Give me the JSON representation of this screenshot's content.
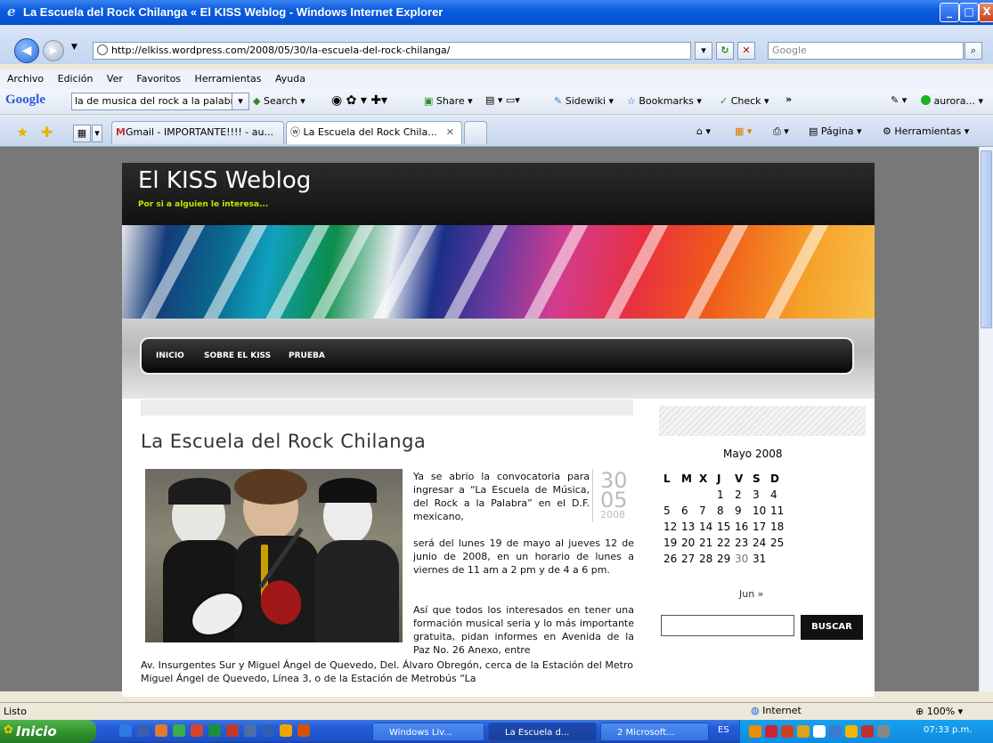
{
  "window": {
    "title": "La Escuela del Rock Chilanga « El KISS Weblog - Windows Internet Explorer",
    "controls": [
      "_",
      "□",
      "X"
    ]
  },
  "address": {
    "url": "http://elkiss.wordpress.com/2008/05/30/la-escuela-del-rock-chilanga/",
    "search_placeholder": "Google"
  },
  "menu": [
    "Archivo",
    "Edición",
    "Ver",
    "Favoritos",
    "Herramientas",
    "Ayuda"
  ],
  "googlebar": {
    "logo": "Google",
    "query": "la de musica del rock a la palabra",
    "search": "Search",
    "share": "Share",
    "sidewiki": "Sidewiki",
    "bookmarks": "Bookmarks",
    "check": "Check",
    "more": "»",
    "user": "aurora..."
  },
  "tabs": [
    {
      "label": "Gmail - IMPORTANTE!!!! - au..."
    },
    {
      "label": "La Escuela del Rock Chila..."
    }
  ],
  "commandbar": {
    "page": "Página",
    "tools": "Herramientas"
  },
  "site": {
    "title": "El KISS Weblog",
    "tagline": "Por si a alguien le interesa...",
    "nav": [
      "INICIO",
      "SOBRE EL KISS",
      "PRUEBA"
    ]
  },
  "post": {
    "title": "La Escuela del Rock Chilanga",
    "date": {
      "day": "30",
      "month": "05",
      "year": "2008"
    },
    "para1a": "Ya se abrio la convocatoria para ingresar a “La Escuela de Música, del Rock a la Palabra” en el D.F. mexicano,",
    "para1b": "será del lunes 19 de mayo al jueves 12 de junio de 2008, en un horario de lunes a viernes de 11 am a 2 pm y de 4 a 6 pm.",
    "para2": "Así que todos los interesados en tener una formación musical seria y lo más importante gratuita, pidan informes en Avenida de la Paz No. 26 Anexo, entre",
    "para3": "Av. Insurgentes Sur y Miguel Ángel de Quevedo, Del. Álvaro Obregón, cerca de la Estación del Metro Miguel Ángel de Quevedo, Línea 3, o de la Estación de Metrobús “La"
  },
  "calendar": {
    "month": "Mayo 2008",
    "headers": [
      "L",
      "M",
      "X",
      "J",
      "V",
      "S",
      "D"
    ],
    "weeks": [
      [
        "",
        "",
        "",
        "1",
        "2",
        "3",
        "4"
      ],
      [
        "5",
        "6",
        "7",
        "8",
        "9",
        "10",
        "11"
      ],
      [
        "12",
        "13",
        "14",
        "15",
        "16",
        "17",
        "18"
      ],
      [
        "19",
        "20",
        "21",
        "22",
        "23",
        "24",
        "25"
      ],
      [
        "26",
        "27",
        "28",
        "29",
        "30",
        "31",
        ""
      ]
    ],
    "next": "Jun »"
  },
  "sidebar": {
    "search_button": "BUSCAR"
  },
  "status": {
    "text": "Listo",
    "zone": "Internet",
    "zoom": "100%"
  },
  "taskbar": {
    "start": "Inicio",
    "tasks": [
      "Windows Liv...",
      "La Escuela d...",
      "2 Microsoft..."
    ],
    "lang": "ES",
    "clock": "07:33 p.m."
  }
}
